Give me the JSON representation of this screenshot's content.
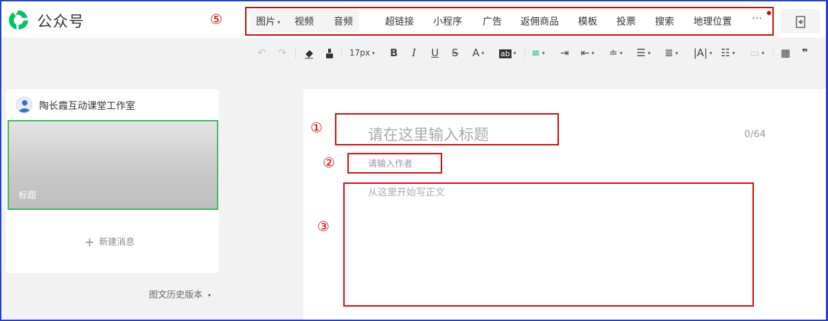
{
  "app": {
    "name": "公众号",
    "brand_color": "#07c160"
  },
  "annotations": {
    "c1": "①",
    "c2": "②",
    "c3": "③",
    "c5": "⑤",
    "color": "#e00000"
  },
  "insert_menu": {
    "items": [
      {
        "label": "图片",
        "has_dropdown": true
      },
      {
        "label": "视频"
      },
      {
        "label": "音频"
      },
      {
        "label": "超链接"
      },
      {
        "label": "小程序"
      },
      {
        "label": "广告"
      },
      {
        "label": "返佣商品"
      },
      {
        "label": "模板"
      },
      {
        "label": "投票"
      },
      {
        "label": "搜索"
      },
      {
        "label": "地理位置"
      },
      {
        "label": "···"
      }
    ]
  },
  "toolbar": {
    "font_size": "17px",
    "bold": "B",
    "italic": "I",
    "underline": "U",
    "strike": "S",
    "font_color": "A",
    "bg_color": "ab",
    "quote": "❞"
  },
  "sidebar": {
    "account_name": "陶长霞互动课堂工作室",
    "cover_title": "标题",
    "new_message": "新建消息",
    "history": "图文历史版本"
  },
  "editor": {
    "title_placeholder": "请在这里输入标题",
    "title_counter": "0/64",
    "author_placeholder": "请输入作者",
    "body_placeholder": "从这里开始写正文"
  }
}
